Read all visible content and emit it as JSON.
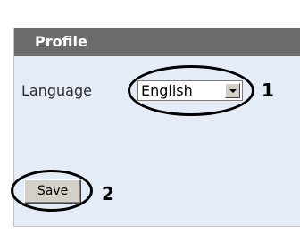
{
  "panel": {
    "title": "Profile"
  },
  "language": {
    "label": "Language",
    "selected": "English",
    "options": [
      "English"
    ]
  },
  "actions": {
    "save_label": "Save"
  },
  "annotations": {
    "callout_1": "1",
    "callout_2": "2"
  },
  "colors": {
    "header_bg": "#6b6b6b",
    "panel_bg": "#e4edf7",
    "button_bg": "#d4d0c8",
    "annotation": "#000000"
  }
}
